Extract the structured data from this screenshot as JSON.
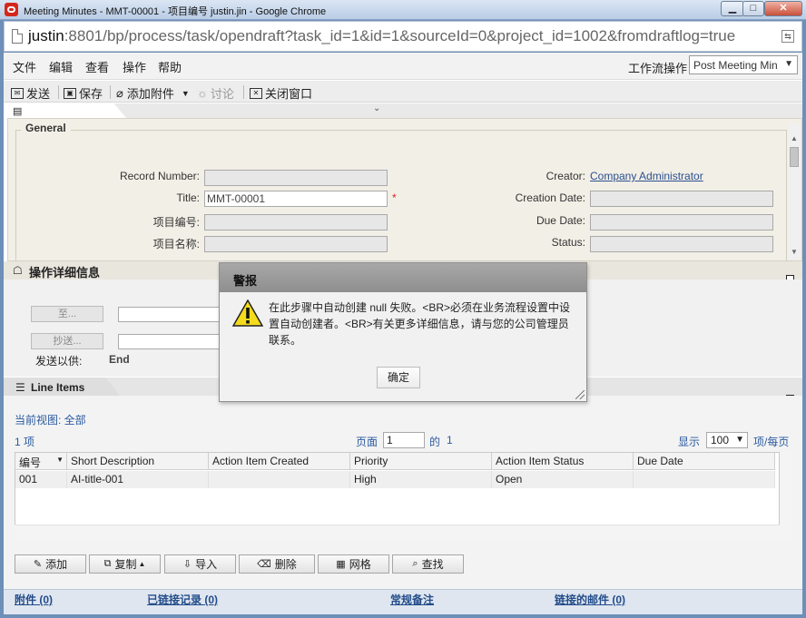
{
  "window": {
    "title": "Meeting Minutes - MMT-00001 - 项目编号 justin.jin - Google Chrome",
    "minimize": "▁",
    "maximize": "□",
    "close": "✕"
  },
  "address": {
    "url_host": "justin",
    "url_rest": ":8801/bp/process/task/opendraft?task_id=1&id=1&sourceId=0&project_id=1002&fromdraftlog=true"
  },
  "menu": {
    "items": [
      "文件",
      "编辑",
      "查看",
      "操作",
      "帮助"
    ],
    "workflow_label": "工作流操作",
    "workflow_value": "Post Meeting Min"
  },
  "toolbar": {
    "send": "发送",
    "save": "保存",
    "attach": "添加附件",
    "discuss": "讨论",
    "close_window": "关闭窗口"
  },
  "general": {
    "legend": "General",
    "record_number_label": "Record Number:",
    "record_number_value": "",
    "title_label": "Title:",
    "title_value": "MMT-00001",
    "required_mark": "*",
    "project_number_label": "项目编号:",
    "project_number_value": "",
    "project_name_label": "项目名称:",
    "project_name_value": "",
    "creator_label": "Creator:",
    "creator_value": "Company Administrator",
    "creation_date_label": "Creation Date:",
    "creation_date_value": "",
    "due_date_label": "Due Date:",
    "due_date_value": "",
    "status_label": "Status:",
    "status_value": ""
  },
  "details": {
    "title": "操作详细信息",
    "to_button": "至...",
    "cc_button": "抄送...",
    "send_for_label": "发送以供:",
    "send_for_value": "End"
  },
  "line_items": {
    "tab_title": "Line Items",
    "current_view": "当前视图: 全部",
    "count_text": "1 项",
    "page_label": "页面",
    "page_value": "1",
    "of_label": "的",
    "of_value": "1",
    "show_label": "显示",
    "per_page_value": "100",
    "per_page_suffix": "项/每页",
    "columns": [
      "编号",
      "Short Description",
      "Action Item Created",
      "Priority",
      "Action Item Status",
      "Due Date"
    ],
    "rows": [
      [
        "001",
        "AI-title-001",
        "",
        "High",
        "Open",
        ""
      ]
    ],
    "buttons": {
      "add": "添加",
      "copy": "复制",
      "import": "导入",
      "delete": "删除",
      "grid": "网格",
      "find": "查找"
    }
  },
  "footer": {
    "attachments": "附件 (0)",
    "linked_records": "已链接记录 (0)",
    "general_notes": "常规备注",
    "linked_mail": "链接的邮件 (0)"
  },
  "modal": {
    "title": "警报",
    "message": "在此步骤中自动创建 null 失败。<BR>必须在业务流程设置中设置自动创建者。<BR>有关更多详细信息，请与您的公司管理员联系。",
    "ok": "确定"
  },
  "colors": {
    "link": "#2b5aa0",
    "modal_header": "#9b9b9b",
    "warning_yellow": "#f3dc1c"
  }
}
